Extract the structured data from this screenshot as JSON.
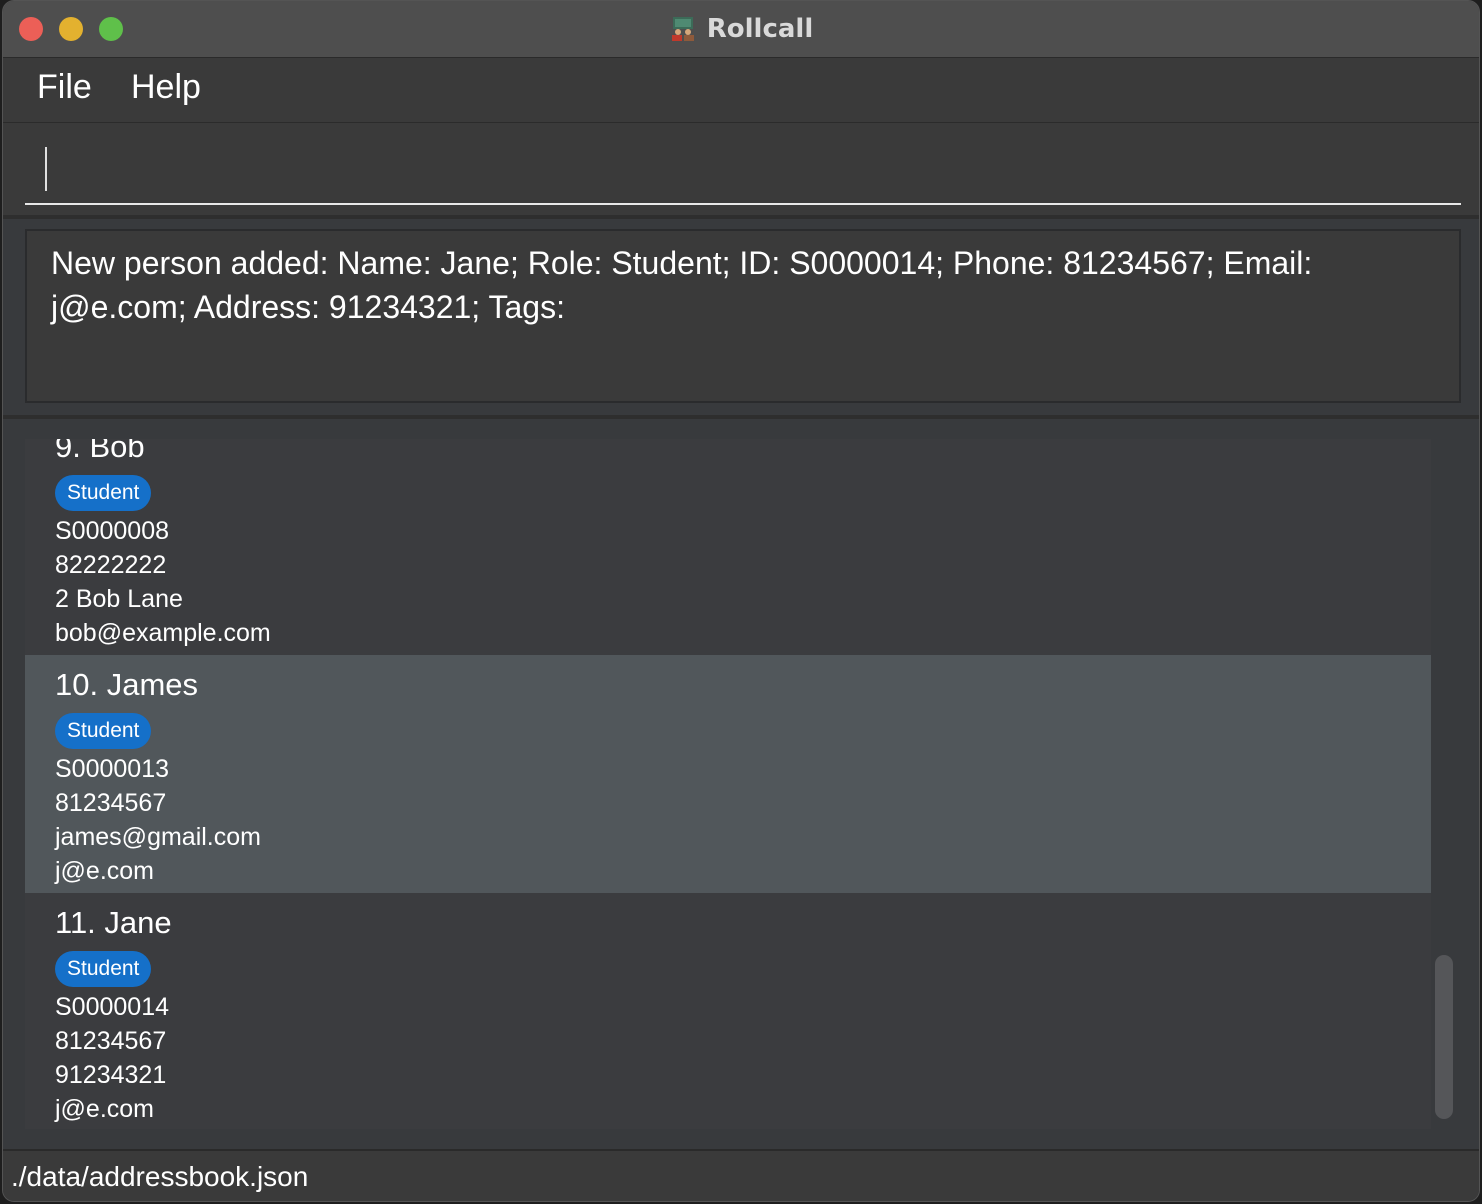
{
  "window": {
    "title": "Rollcall",
    "icon": "classroom-app-icon"
  },
  "menu": {
    "file": "File",
    "help": "Help"
  },
  "command": {
    "value": "",
    "placeholder": ""
  },
  "result": {
    "message": "New person added: Name: Jane; Role: Student; ID: S0000014; Phone: 81234567; Email: j@e.com; Address: 91234321; Tags:"
  },
  "persons": [
    {
      "index_name": "9. Bob",
      "role": "Student",
      "fields": [
        "S0000008",
        "82222222",
        "2 Bob Lane",
        "bob@example.com"
      ],
      "selected": false
    },
    {
      "index_name": "10. James",
      "role": "Student",
      "fields": [
        "S0000013",
        "81234567",
        "james@gmail.com",
        "j@e.com"
      ],
      "selected": true
    },
    {
      "index_name": "11. Jane",
      "role": "Student",
      "fields": [
        "S0000014",
        "81234567",
        "91234321",
        "j@e.com"
      ],
      "selected": false
    }
  ],
  "status": {
    "path": "./data/addressbook.json"
  },
  "colors": {
    "badge": "#1570c9",
    "selected_row": "#51575b",
    "background": "#383a3d"
  }
}
